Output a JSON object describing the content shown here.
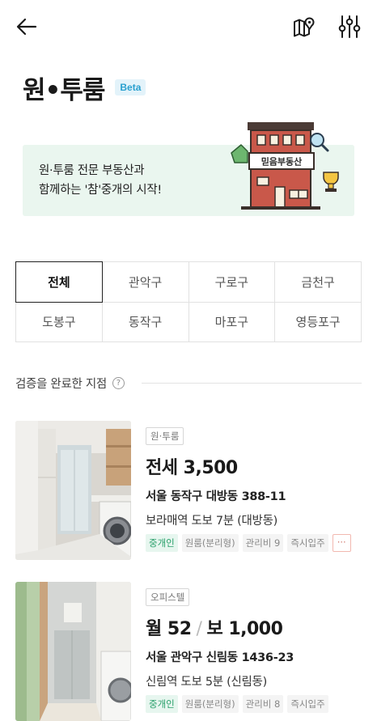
{
  "header": {
    "title": "원•투룸",
    "badge": "Beta"
  },
  "banner": {
    "line1": "원·투룸 전문 부동산과",
    "line2": "함께하는 '참'중개의 시작!",
    "sign": "믿음부동산"
  },
  "tabs": [
    "전체",
    "관악구",
    "구로구",
    "금천구",
    "도봉구",
    "동작구",
    "마포구",
    "영등포구"
  ],
  "active_tab": "전체",
  "section": {
    "title": "검증을 완료한 지점",
    "help": "?"
  },
  "listings": [
    {
      "type": "원·투룸",
      "price_label": "전세",
      "price_value": "3,500",
      "address": "서울 동작구 대방동 388-11",
      "station": "보라매역 도보 7분 (대방동)",
      "chips": [
        "중개인",
        "원룸(분리형)",
        "관리비 9",
        "즉시입주"
      ],
      "more": "···"
    },
    {
      "type": "오피스텔",
      "price_label": "월 52",
      "price_sep": "/",
      "price_value": "보 1,000",
      "address": "서울 관악구 신림동 1436-23",
      "station": "신림역 도보 5분 (신림동)",
      "chips": [
        "중개인",
        "원룸(분리형)",
        "관리비 8",
        "즉시입주"
      ]
    }
  ],
  "colors": {
    "banner_bg": "#eaf6ef",
    "agent_chip": "#2aa06b",
    "beta_text": "#29a0cf"
  },
  "icons": [
    "back-arrow-icon",
    "map-icon",
    "filter-sliders-icon",
    "help-icon"
  ]
}
